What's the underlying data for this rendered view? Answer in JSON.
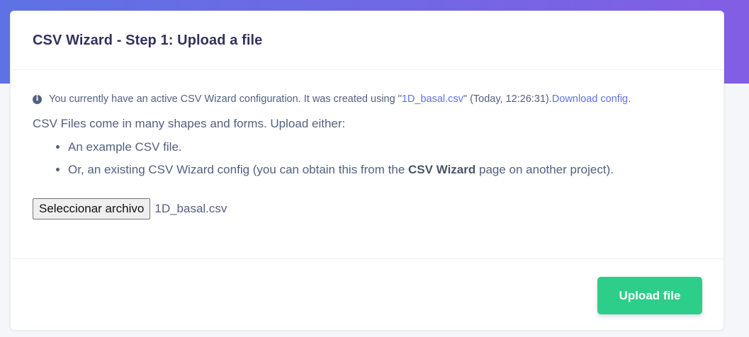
{
  "card": {
    "title": "CSV Wizard - Step 1: Upload a file"
  },
  "info": {
    "icon": "info-icon",
    "text_before": "You currently have an active CSV Wizard configuration. It was created using \"",
    "file_link": "1D_basal.csv",
    "text_after": "\" (Today, 12:26:31). ",
    "download_link": "Download config",
    "trailing": "."
  },
  "intro": "CSV Files come in many shapes and forms. Upload either:",
  "options": {
    "item1": "An example CSV file.",
    "item2_before": "Or, an existing CSV Wizard config (you can obtain this from the ",
    "item2_bold": "CSV Wizard",
    "item2_after": " page on another project)."
  },
  "file_input": {
    "button_label": "Seleccionar archivo",
    "selected_file": "1D_basal.csv"
  },
  "footer": {
    "upload_label": "Upload file"
  },
  "colors": {
    "hero_gradient_start": "#5e72e4",
    "hero_gradient_end": "#825ee4",
    "primary_link": "#5e72e4",
    "success_button": "#2dce89",
    "title_text": "#32325d",
    "body_text": "#525f7f"
  }
}
